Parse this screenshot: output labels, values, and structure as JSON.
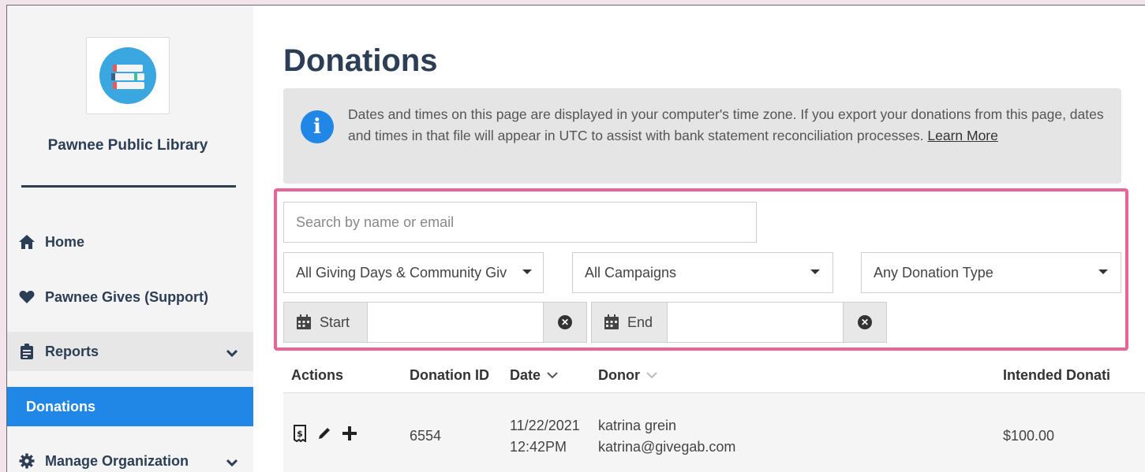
{
  "sidebar": {
    "org_name": "Pawnee Public Library",
    "nav": {
      "home": "Home",
      "support": "Pawnee Gives (Support)",
      "reports": "Reports",
      "donations": "Donations",
      "manage": "Manage Organization"
    }
  },
  "page": {
    "title": "Donations",
    "notice_text": "Dates and times on this page are displayed in your computer's time zone. If you export your donations from this page, dates and times in that file will appear in UTC to assist with bank statement reconciliation processes.",
    "notice_link": "Learn More"
  },
  "filters": {
    "search_placeholder": "Search by name or email",
    "giving_days": "All Giving Days & Community Giv",
    "campaigns": "All Campaigns",
    "donation_type": "Any Donation Type",
    "start_label": "Start",
    "end_label": "End"
  },
  "table": {
    "headers": {
      "actions": "Actions",
      "donation_id": "Donation ID",
      "date": "Date",
      "donor": "Donor",
      "intended": "Intended Donati"
    },
    "rows": [
      {
        "id": "6554",
        "date": "11/22/2021",
        "time": "12:42PM",
        "donor_name": "katrina grein",
        "donor_email": "katrina@givegab.com",
        "amount": "$100.00"
      }
    ]
  },
  "colors": {
    "accent": "#2187e6",
    "highlight": "#e8659a",
    "heading": "#2c3e55"
  }
}
